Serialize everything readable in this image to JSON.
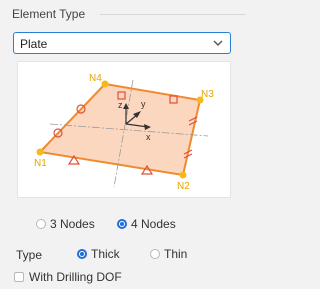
{
  "group": {
    "title": "Element Type"
  },
  "element_type_select": {
    "selected": "Plate"
  },
  "preview": {
    "node_labels": [
      "N1",
      "N2",
      "N3",
      "N4"
    ],
    "axis_labels": {
      "x": "x",
      "y": "y",
      "z": "z"
    },
    "colors": {
      "fill": "#fbd7bf",
      "edge": "#f08a2e",
      "node": "#f6b81a",
      "marker": "#e0503a",
      "axis": "#333333"
    }
  },
  "nodes_options": [
    {
      "label": "3 Nodes",
      "selected": false
    },
    {
      "label": "4 Nodes",
      "selected": true
    }
  ],
  "type_row": {
    "label": "Type",
    "options": [
      {
        "label": "Thick",
        "selected": true
      },
      {
        "label": "Thin",
        "selected": false
      }
    ]
  },
  "drilling_dof": {
    "label": "With Drilling DOF",
    "checked": false
  },
  "accent_color": "#1f6fd6"
}
